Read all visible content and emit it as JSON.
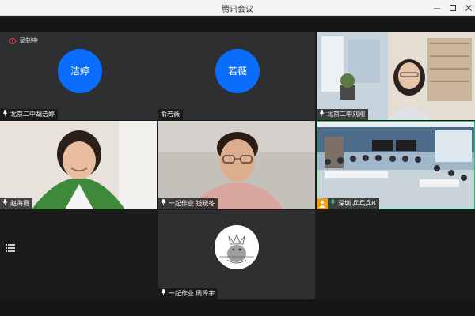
{
  "window": {
    "title": "腾讯会议",
    "minimize_icon": "minimize-icon",
    "maximize_icon": "maximize-icon",
    "close_icon": "close-icon"
  },
  "recording": {
    "label": "录制中",
    "icon": "record-icon"
  },
  "participants": [
    {
      "id": "p1",
      "name": "北京二中胡洁婷",
      "avatar_text": "洁婷",
      "kind": "avatar",
      "avatar_color": "#0b6dfc"
    },
    {
      "id": "p2",
      "name": "俞若薇",
      "avatar_text": "若薇",
      "kind": "avatar",
      "avatar_color": "#0b6dfc"
    },
    {
      "id": "p3",
      "name": "北京二中刘刚",
      "kind": "video"
    },
    {
      "id": "p4",
      "name": "赵海霞",
      "kind": "video"
    },
    {
      "id": "p5",
      "name": "一起作业 钱晓冬",
      "kind": "video"
    },
    {
      "id": "p6",
      "name": "深圳 乒乓乒B",
      "kind": "video",
      "active_speaker": true
    },
    {
      "id": "p7",
      "name": "一起作业 周泽宇",
      "kind": "avatar-image"
    }
  ],
  "colors": {
    "accent": "#0b6dfc",
    "active_border": "#2bbf68",
    "tile_bg": "#2e2f31",
    "background": "#1b1b1b"
  },
  "sidebar": {
    "list_icon": "list-icon"
  }
}
